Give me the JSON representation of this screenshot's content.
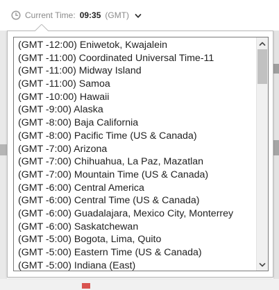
{
  "header": {
    "label": "Current Time:",
    "time": "09:35",
    "timezone": "(GMT)",
    "icons": {
      "clock": "clock-icon",
      "dropdown": "chevron-down-icon"
    }
  },
  "timezone_list": {
    "options": [
      "(GMT -12:00) Eniwetok, Kwajalein",
      "(GMT -11:00) Coordinated Universal Time-11",
      "(GMT -11:00) Midway Island",
      "(GMT -11:00) Samoa",
      "(GMT -10:00) Hawaii",
      "(GMT -9:00) Alaska",
      "(GMT -8:00) Baja California",
      "(GMT -8:00) Pacific Time (US & Canada)",
      "(GMT -7:00) Arizona",
      "(GMT -7:00) Chihuahua, La Paz, Mazatlan",
      "(GMT -7:00) Mountain Time (US & Canada)",
      "(GMT -6:00) Central America",
      "(GMT -6:00) Central Time (US & Canada)",
      "(GMT -6:00) Guadalajara, Mexico City, Monterrey",
      "(GMT -6:00) Saskatchewan",
      "(GMT -5:00) Bogota, Lima, Quito",
      "(GMT -5:00) Eastern Time (US & Canada)",
      "(GMT -5:00) Indiana (East)"
    ],
    "scrollbar": {
      "up_icon": "chevron-up-icon",
      "down_icon": "chevron-down-icon"
    }
  },
  "colors": {
    "header_muted": "#8a8a8a",
    "header_strong": "#222222",
    "list_text": "#1f1f1f",
    "list_border": "#7a7a7a",
    "popup_border": "#b9b9b9",
    "scroll_thumb": "#c1c1c1"
  }
}
